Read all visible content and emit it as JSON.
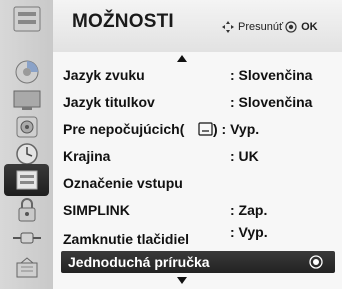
{
  "menu": {
    "title": "MOŽNOSTI",
    "hint": {
      "move_label": "Presunúť",
      "ok_label": "OK"
    }
  },
  "sidebar": {
    "icons": [
      "disc-icon",
      "monitor-icon",
      "speaker-icon",
      "clock-icon",
      "options-icon",
      "lock-icon",
      "input-icon",
      "usb-icon"
    ],
    "selected_index": 4
  },
  "settings": [
    {
      "label": "Jazyk zvuku",
      "value": ": Slovenčina"
    },
    {
      "label": "Jazyk titulkov",
      "value": ": Slovenčina"
    },
    {
      "label": "Pre nepočujúcich(",
      "value": ") : Vyp."
    },
    {
      "label": "Krajina",
      "value": ": UK"
    },
    {
      "label": "Označenie vstupu",
      "value": ""
    },
    {
      "label": "SIMPLINK",
      "value": ": Zap."
    },
    {
      "label": "Zamknutie tlačidiel",
      "value": ": Vyp."
    }
  ],
  "selected_item": {
    "label": "Jednoduchá príručka"
  },
  "colors": {
    "highlight": "#2b2b2b",
    "panel": "#f7f7f7"
  }
}
